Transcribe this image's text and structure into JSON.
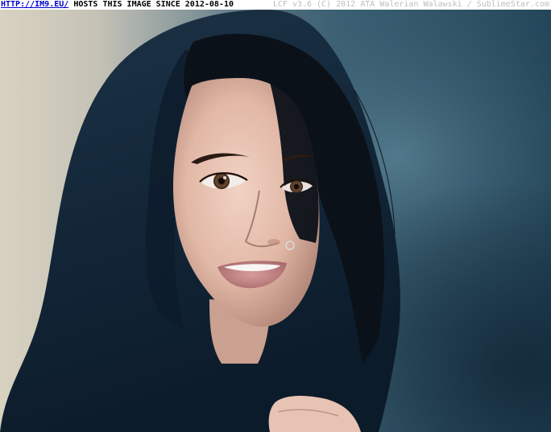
{
  "header": {
    "link_text": "HTTP://IM9.EU/",
    "hosts_text": " HOSTS THIS IMAGE SINCE 2012-08-10",
    "credit_text": "LCF v3.6 (C) 2012 ATA Walerian Walawski / SublimeStar.com"
  },
  "colors": {
    "link": "#0000cc",
    "credit": "#bdbdbd",
    "background_left": "#d8d2c0",
    "background_right": "#2f5468",
    "scarf": "#13263a",
    "skin": "#e9c4b4"
  },
  "photo": {
    "subject": "portrait-woman-dark-scarf"
  }
}
